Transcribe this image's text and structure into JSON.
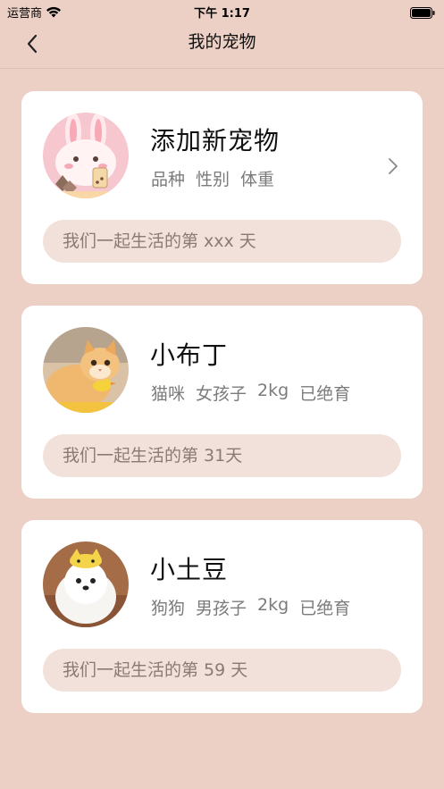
{
  "status_bar": {
    "carrier": "运营商",
    "time": "下午 1:17"
  },
  "nav": {
    "title": "我的宠物",
    "back_icon": "chevron-left-icon"
  },
  "pets": [
    {
      "name": "添加新宠物",
      "info": [
        "品种",
        "性别",
        "体重"
      ],
      "days_text": "我们一起生活的第 xxx 天",
      "avatar": "bunny-placeholder",
      "show_chevron": true
    },
    {
      "name": "小布丁",
      "info": [
        "猫咪",
        "女孩子",
        "2kg",
        "已绝育"
      ],
      "days_text": "我们一起生活的第 31天",
      "avatar": "cat-photo",
      "show_chevron": false
    },
    {
      "name": "小土豆",
      "info": [
        "狗狗",
        "男孩子",
        "2kg",
        "已绝育"
      ],
      "days_text": "我们一起生活的第 59 天",
      "avatar": "dog-photo",
      "show_chevron": false
    }
  ],
  "colors": {
    "background": "#ecd0c5",
    "card": "#ffffff",
    "pill": "#f2e1da",
    "secondary_text": "#7b7b7b"
  }
}
